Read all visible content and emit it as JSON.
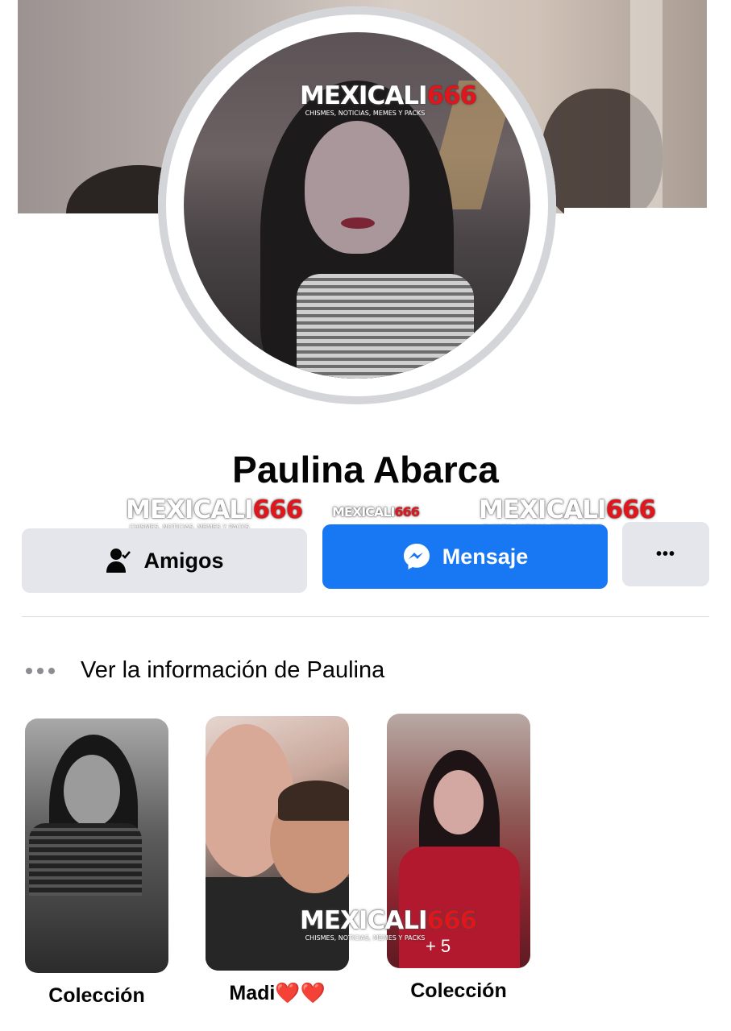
{
  "profile": {
    "name": "Paulina Abarca"
  },
  "actions": {
    "friends_label": "Amigos",
    "message_label": "Mensaje",
    "more_label": "•••"
  },
  "info": {
    "label": "Ver la información de Paulina"
  },
  "highlights": [
    {
      "caption": "Colección"
    },
    {
      "caption": "Madi❤️❤️"
    },
    {
      "caption": "Colección",
      "count": "5"
    }
  ],
  "watermark": {
    "brand_text": "MEXICALI",
    "brand_number": "666",
    "tagline": "CHISMES, NOTICIAS, MEMES Y PACKS"
  },
  "colors": {
    "primary_button": "#1877f2",
    "secondary_button": "#e4e6eb",
    "watermark_red": "#e0161c"
  }
}
